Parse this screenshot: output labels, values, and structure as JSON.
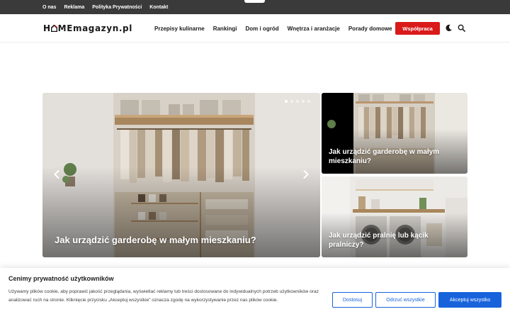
{
  "topbar": {
    "links": [
      "O nas",
      "Reklama",
      "Polityka Prywatności",
      "Kontakt"
    ]
  },
  "header": {
    "logo_home": "H MEmagazyn",
    "logo_domain": ".pl",
    "nav": [
      "Przepisy kulinarne",
      "Rankingi",
      "Dom i ogród",
      "Wnętrza i aranżacje",
      "Porady domowe"
    ],
    "cta_label": "Współpraca",
    "icons": [
      "moon-icon",
      "search-icon"
    ]
  },
  "featured": {
    "main": {
      "title": "Jak urządzić garderobę w małym mieszkaniu?"
    },
    "side": [
      {
        "title": "Jak urządzić garderobę w małym mieszkaniu?"
      },
      {
        "title": "Jak urządzić pralnię lub kącik pralniczy?"
      }
    ],
    "slider_dots": 5,
    "active_dot": 1
  },
  "cookie": {
    "title": "Cenimy prywatność użytkowników",
    "text": "Używamy plików cookie, aby poprawić jakość przeglądania, wyświetlać reklamy lub treści dostosowane do indywidualnych potrzeb użytkowników oraz analizować ruch na stronie. Kliknięcie przycisku „Akceptuj wszystkie” oznacza zgodę na wykorzystywanie przez nas plików cookie.",
    "buttons": {
      "customize": "Dostosuj",
      "reject": "Odrzuć wszystkie",
      "accept": "Akceptuj wszystko"
    }
  },
  "colors": {
    "topbar": "#3a3a3a",
    "cta": "#d91a1a",
    "cookie_accent": "#1863dc"
  }
}
